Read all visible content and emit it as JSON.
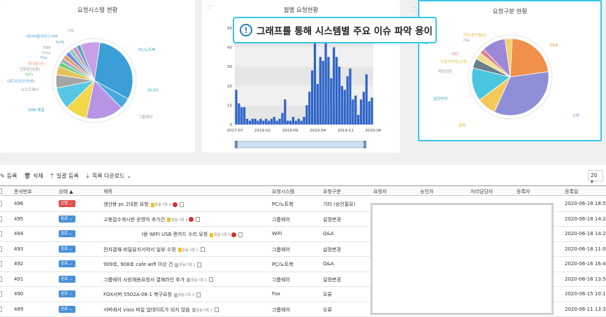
{
  "callout": {
    "text": "그래프를 통해 시스템별 주요 이슈 파악 용이",
    "icon": "!"
  },
  "card1": {
    "title": "요청시스템 현황",
    "labels": [
      "기타",
      "네이버클라우드서버",
      "SVN",
      "ERP",
      "Diag",
      "Fox",
      "휴대폰(폰)",
      "전화변경(좀)",
      "WiFi",
      "네트워크(인터넷)",
      "소프트웨어",
      "OR6 메일",
      "PC/노트북",
      "모니터",
      "그룹웨어"
    ],
    "slices": [
      {
        "name": "PC/노트북",
        "value": 33,
        "color": "#3b9ed6"
      },
      {
        "name": "모니터",
        "value": 5,
        "color": "#4aa8e0"
      },
      {
        "name": "그룹웨어",
        "value": 17,
        "color": "#b894e6"
      },
      {
        "name": "a",
        "value": 10,
        "color": "#f3d74a"
      },
      {
        "name": "OR6 메일",
        "value": 10,
        "color": "#55c7e2"
      },
      {
        "name": "소프트웨어",
        "value": 6,
        "color": "#a5a5a5"
      },
      {
        "name": "네트워크",
        "value": 4,
        "color": "#e6c35a"
      },
      {
        "name": "WiFi",
        "value": 2,
        "color": "#6fcf7a"
      },
      {
        "name": "전화변경",
        "value": 2,
        "color": "#9fb0c0"
      },
      {
        "name": "휴대폰",
        "value": 2,
        "color": "#e89b6c"
      },
      {
        "name": "Fox",
        "value": 2,
        "color": "#7b86d8"
      },
      {
        "name": "Diag",
        "value": 2,
        "color": "#86d0c0"
      },
      {
        "name": "ERP",
        "value": 2,
        "color": "#d68fc8"
      },
      {
        "name": "SVN",
        "value": 2,
        "color": "#5ca6b5"
      },
      {
        "name": "기타",
        "value": 9,
        "color": "#c9a0e8"
      }
    ]
  },
  "card2": {
    "title": "월별 요청현황",
    "y_ticks": [
      "50",
      "40",
      "30",
      "20",
      "10",
      "0"
    ],
    "x_ticks": [
      "2017-07",
      "2019-02",
      "2019-09",
      "2019-04",
      "2019-11",
      "2020-06"
    ]
  },
  "chart_data": {
    "type": "bar",
    "title": "월별 요청현황",
    "ylim": [
      0,
      50
    ],
    "x_ticks": [
      "2017-07",
      "2019-02",
      "2019-09",
      "2019-04",
      "2019-11",
      "2020-06"
    ],
    "values": [
      18,
      11,
      9,
      9,
      3,
      2,
      3,
      3,
      2,
      3,
      2,
      3,
      2,
      3,
      4,
      2,
      3,
      6,
      13,
      2,
      2,
      4,
      2,
      3,
      2,
      4,
      10,
      17,
      28,
      42,
      21,
      35,
      33,
      47,
      35,
      24,
      40,
      35,
      30,
      20,
      18,
      25,
      29,
      13,
      15,
      5,
      13,
      17,
      26,
      12,
      14
    ]
  },
  "card3": {
    "title": "요청구분 현황",
    "labels": [
      "기타(승인필요)",
      "기타",
      "Q&A",
      "데이",
      "사용자변경(고정)",
      "계정신청",
      "설정변경",
      "설치",
      "오류"
    ],
    "slices": [
      {
        "name": "Q&A",
        "value": 22,
        "color": "#f0904a"
      },
      {
        "name": "오류",
        "value": 34,
        "color": "#8f8fd8"
      },
      {
        "name": "설치",
        "value": 8,
        "color": "#f3c95a"
      },
      {
        "name": "설정변경",
        "value": 14,
        "color": "#49c6e0"
      },
      {
        "name": "계정신청",
        "value": 4,
        "color": "#6a7f8c"
      },
      {
        "name": "사용자변경",
        "value": 3,
        "color": "#f0e088"
      },
      {
        "name": "데이",
        "value": 2,
        "color": "#e08090"
      },
      {
        "name": "기타",
        "value": 10,
        "color": "#9b88d6"
      },
      {
        "name": "기타(승인필요)",
        "value": 3,
        "color": "#f3d070"
      }
    ]
  },
  "toolbar": {
    "add": "등록",
    "delete": "삭제",
    "bulk": "일괄 등록",
    "download": "목록 다운로드 ",
    "page_size": "20"
  },
  "columns": {
    "num": "문서번호",
    "status": "상태 ▲",
    "title": "제목",
    "system": "요청시스템",
    "type": "요청구분",
    "requester": "요청자",
    "approver": "승인자",
    "handler": "처리담당자",
    "registrant": "등록자",
    "date": "등록일"
  },
  "rows": [
    {
      "num": "496",
      "status": "진행",
      "status_class": "st-new",
      "title": "생산용 pc 2대본 요청",
      "badge": "활동기록 1",
      "flag": "yellow",
      "rc": true,
      "system": "PC/노트북",
      "type": "기타 (승인필요)",
      "date": "2020-06-18 18:53"
    },
    {
      "num": "495",
      "status": "완료",
      "status_class": "st-done",
      "title": "고충접수게시판 운영자 추가건",
      "badge": "활동기록 1",
      "flag": "yellow",
      "rc": true,
      "system": "그룹웨어",
      "type": "설정변경",
      "date": "2020-06-18 14:28"
    },
    {
      "num": "494",
      "status": "완료",
      "status_class": "st-done",
      "title": "I용 WIFI USB 랜카드 수리 요청",
      "badge": "활동기록 1",
      "flag": "yellow",
      "rc": true,
      "system": "WiFi",
      "type": "Q&A",
      "date": "2020-06-18 14:24"
    },
    {
      "num": "493",
      "status": "완료",
      "status_class": "st-done",
      "title": "전자결재-비밀유지서약서 일부 수정",
      "badge": "활동기록 1",
      "flag": "yellow",
      "rc": false,
      "system": "그룹웨어",
      "type": "설정변경",
      "date": "2020-06-18 11:01"
    },
    {
      "num": "492",
      "status": "완료",
      "status_class": "st-done",
      "title": "909호, 908호 cafe wifi 이상 건",
      "badge": "활동기록 1",
      "flag": "gray",
      "rc": false,
      "system": "PC/노트북",
      "type": "Q&A",
      "date": "2020-06-16 16:47"
    },
    {
      "num": "491",
      "status": "완료",
      "status_class": "st-done",
      "title": "그룹웨어 사원채용요청서 결재라인 추가",
      "badge": "활동기록 1",
      "flag": "gray",
      "rc": false,
      "system": "그룹웨어",
      "type": "설정변경",
      "date": "2020-06-16 13:56"
    },
    {
      "num": "490",
      "status": "완료",
      "status_class": "st-done",
      "title": "FOX서버 5502A-08-1 복구요청",
      "badge": "활동기록 1",
      "flag": "gray",
      "rc": false,
      "system": "Fox",
      "type": "오류",
      "date": "2020-06-15 10:19"
    },
    {
      "num": "489",
      "status": "완료",
      "status_class": "st-done",
      "title": "서버에서 visio 파일 업데이트가 되지 않음",
      "badge": "활동기록 1",
      "flag": "gray",
      "rc": false,
      "system": "그룹웨어",
      "type": "오류",
      "date": "2020-06-11 13:33"
    }
  ]
}
